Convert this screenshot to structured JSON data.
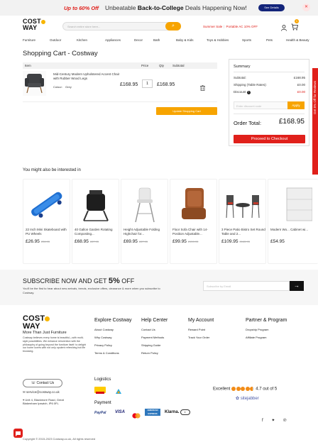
{
  "promo_bar": {
    "highlight": "Up to 60% Off",
    "text_before": "Unbeatable ",
    "text_bold": "Back-to-College",
    "text_after": " Deals Happening Now!",
    "button": "See Details"
  },
  "header": {
    "logo_line1": "COST",
    "logo_line2": "WAY",
    "search_placeholder": "Search entire store here...",
    "promo_left": "Summer Sale",
    "promo_right": "Portable AC 10% OFF",
    "cart_count": "1"
  },
  "nav": [
    "Furniture",
    "Outdoor",
    "Kitchen",
    "Appliances",
    "Decor",
    "Bath",
    "Baby & Kids",
    "Toys & Hobbies",
    "Sports",
    "Pets",
    "Health & Beauty"
  ],
  "page_title": "Shopping Cart - Costway",
  "cart": {
    "columns": [
      "Item",
      "Price",
      "Qty",
      "Subtotal"
    ],
    "item": {
      "name": "Mid-Century Modern Upholstered Accent Chair with Rubber Wood Legs",
      "attr_label": "Colour:",
      "attr_value": "Grey",
      "price": "£168.95",
      "qty": "1",
      "subtotal": "£168.95"
    },
    "update_button": "Update Shopping Cart"
  },
  "summary": {
    "title": "Summary",
    "subtotal_label": "Subtotal:",
    "subtotal_value": "£168.95",
    "shipping_label": "Shipping (Table Rates):",
    "shipping_value": "£0.00",
    "discount_label": "Discount",
    "discount_value": "£0.00",
    "coupon_placeholder": "Enter discount code",
    "apply_button": "Apply",
    "order_total_label": "Order Total:",
    "order_total_value": "£168.95",
    "checkout_button": "Proceed to Checkout"
  },
  "side_tab": "Get 5% Off for Reviews",
  "recommendations": {
    "title": "You might also be interested in",
    "items": [
      {
        "name": "22 Inch Mini Skateboard with PU Wheels",
        "price": "£26.95",
        "old_price": "£36.95",
        "icon": "skateboard-image"
      },
      {
        "name": "40 Gallon Garden Rotating Composting...",
        "price": "£68.95",
        "old_price": "£87.95",
        "icon": "composter-image"
      },
      {
        "name": "Height Adjustable Folding Highchair for...",
        "price": "£69.95",
        "old_price": "£87.95",
        "icon": "highchair-image"
      },
      {
        "name": "Floor Sofa Chair with 14-Position Adjustable...",
        "price": "£99.95",
        "old_price": "£159.95",
        "icon": "floor-chair-image"
      },
      {
        "name": "3 Piece Patio Bistro Set Round Table and 2...",
        "price": "£109.95",
        "old_price": "£165.95",
        "icon": "bistro-set-image"
      },
      {
        "name": "Modern Wo... Cabinet wi...",
        "price": "£54.95",
        "old_price": "",
        "icon": "cabinet-image"
      }
    ]
  },
  "subscribe": {
    "title_before": "SUBSCRIBE NOW AND GET ",
    "title_bold": "5%",
    "title_after": " OFF",
    "description": "You'll be the first to hear about new arrivals, trends, exclusive offers, clearance & more when you subscribe to Costway.",
    "placeholder": "Subscribe by Email"
  },
  "footer": {
    "tagline": "More Than Just Furniture",
    "about": "Costway believes every home is beautiful—with multi-style possibilities. We enhance reinvention with the philosophy of going beyond the furniture itself: to delight our home lovers with not only opulent refreshing but life browsing.",
    "columns": [
      {
        "title": "Explore Costway",
        "links": [
          "About Costway",
          "Why Costway",
          "Privacy Policy",
          "Terms & Conditions"
        ]
      },
      {
        "title": "Help Center",
        "links": [
          "Contact Us",
          "Payment Methods",
          "Shipping Guide",
          "Return Policy"
        ]
      },
      {
        "title": "My Account",
        "links": [
          "Reward Point",
          "Track Your Order"
        ]
      },
      {
        "title": "Partner & Program",
        "links": [
          "Dropship Program",
          "Affiliate Program"
        ]
      }
    ],
    "contact_button": "Contact Us",
    "email": "service@costway.co.uk",
    "address": "Unit 4, Blackmore Road, Great Blakenham Ipswich, IP6 0FL",
    "logistics_title": "Logistics",
    "payment_title": "Payment",
    "payments": [
      "PayPal",
      "VISA",
      "AMERICAN EXPRESS",
      "Klarna."
    ],
    "rating_label": "Excellent",
    "rating_value": "4.7 out of 5",
    "rating_stars": 4.7,
    "review_site": "sitejabber",
    "copyright": "Copyright © 2015-2023 Costway.co.uk, All rights reserved"
  },
  "colors": {
    "brand_orange": "#f7a400",
    "accent_red": "#e0201b",
    "promo_button": "#13247a"
  }
}
